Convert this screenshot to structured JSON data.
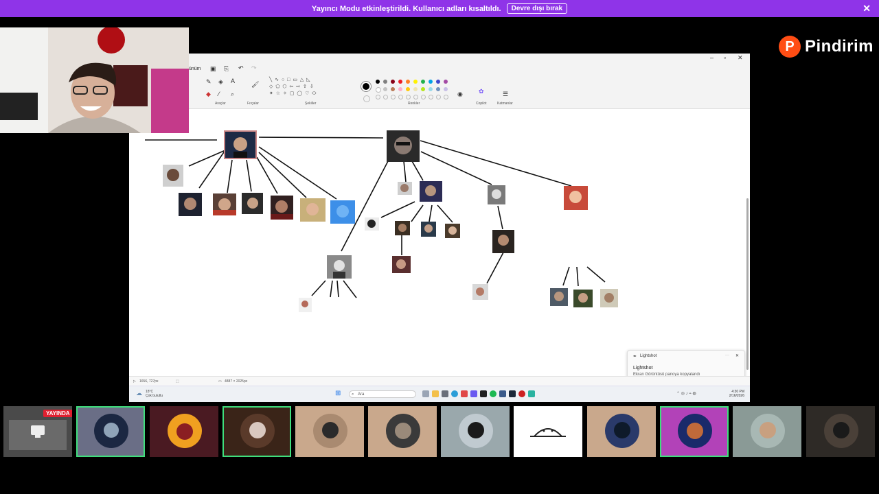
{
  "banner": {
    "message": "Yayıncı Modu etkinleştirildi. Kullanıcı adları kısaltıldı.",
    "disable_button": "Devre dışı bırak"
  },
  "brand": {
    "logo_letter": "P",
    "name": "Pindirim",
    "color": "#ff4d14"
  },
  "paint": {
    "menu_label": "ünüm",
    "groups": [
      "Araçlar",
      "Fırçalar",
      "Şekiller",
      "Renkler",
      "Copilot",
      "Katmanlar"
    ],
    "colors": [
      "#000000",
      "#7f7f7f",
      "#880015",
      "#ed1c24",
      "#ff7f27",
      "#fff200",
      "#22b14c",
      "#00a2e8",
      "#3f48cc",
      "#a349a4",
      "#ffffff",
      "#c3c3c3",
      "#b97a57",
      "#ffaec9",
      "#ffc90e",
      "#efe4b0",
      "#b5e61d",
      "#99d9ea",
      "#7092be",
      "#c8bfe7"
    ]
  },
  "statusbar": {
    "cursor_position": "1656, 727px",
    "canvas_size": "4887 × 2025px"
  },
  "taskbar": {
    "temperature": "18°C",
    "weather_text": "Çok bulutlu",
    "search_placeholder": "Ara",
    "time": "4:30 PM",
    "date": "2/16/2026"
  },
  "toast": {
    "app_name": "Lightshot",
    "title": "Lightshot",
    "message": "Ekran Görüntüsü panoya kopyalandı"
  },
  "call": {
    "live_badge": "YAYINDA",
    "accent": "#3fdf7c"
  }
}
